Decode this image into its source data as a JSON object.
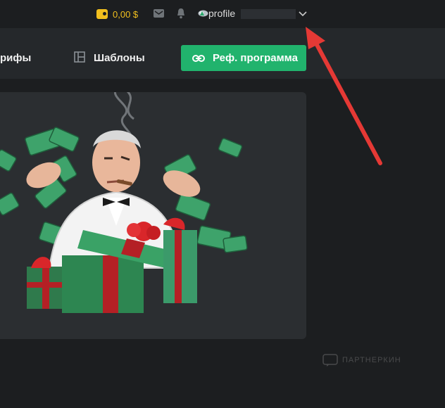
{
  "header": {
    "balance": "0,00 $",
    "profile_label": "profile"
  },
  "nav": {
    "tariffs_label": "рифы",
    "templates_label": "Шаблоны",
    "ref_button_label": "Реф. программа"
  },
  "watermark": {
    "text": "ПАРТНЕРКИН"
  },
  "colors": {
    "background": "#1c1e20",
    "nav_background": "#25282b",
    "card_background": "#2b2e31",
    "accent_green": "#21b36d",
    "balance_yellow": "#f2c01e",
    "annotation_red": "#e53935"
  },
  "icons": [
    "wallet-icon",
    "mail-icon",
    "bell-icon",
    "avatar",
    "chevron-down-icon",
    "templates-icon",
    "link-icon"
  ]
}
